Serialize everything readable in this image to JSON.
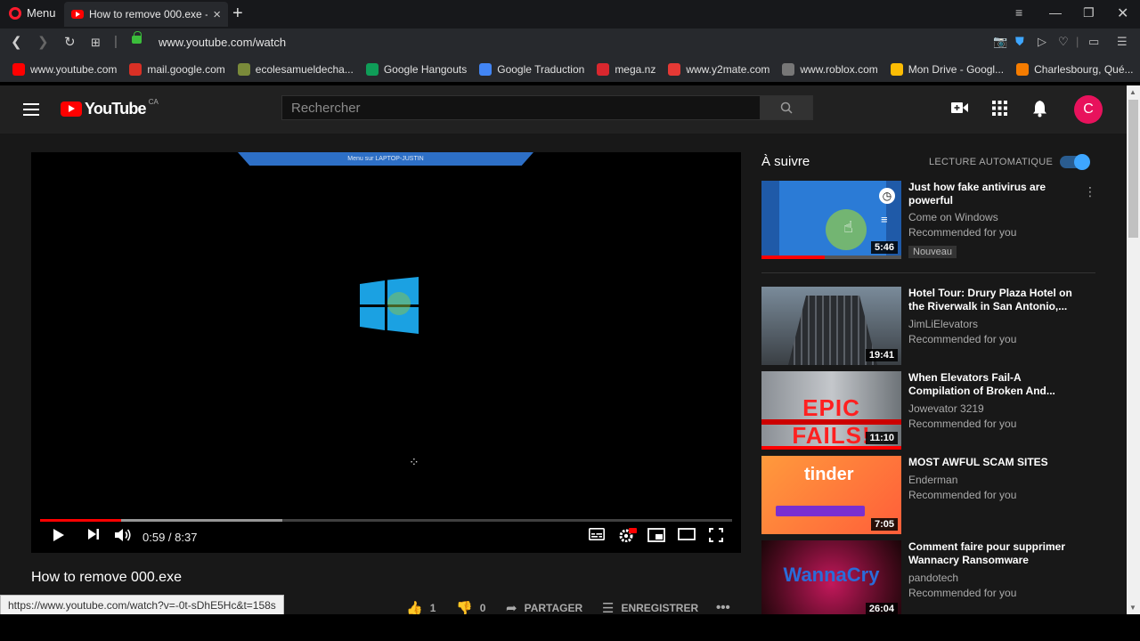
{
  "browser": {
    "menu_label": "Menu",
    "tab_title": "How to remove 000.exe - YouTube",
    "tab_close": "×",
    "new_tab": "+",
    "url": "www.youtube.com/watch",
    "bookmarks": [
      {
        "label": "www.youtube.com",
        "color": "#ff0000"
      },
      {
        "label": "mail.google.com",
        "color": "#d93025"
      },
      {
        "label": "ecolesamueldecha...",
        "color": "#7a8a3a"
      },
      {
        "label": "Google Hangouts",
        "color": "#0f9d58"
      },
      {
        "label": "Google Traduction",
        "color": "#4285f4"
      },
      {
        "label": "mega.nz",
        "color": "#d9272e"
      },
      {
        "label": "www.y2mate.com",
        "color": "#e53935"
      },
      {
        "label": "www.roblox.com",
        "color": "#777777"
      },
      {
        "label": "Mon Drive - Googl...",
        "color": "#fbbc04"
      },
      {
        "label": "Charlesbourg, Qué...",
        "color": "#f57c00"
      }
    ],
    "status_url": "https://www.youtube.com/watch?v=-0t-sDhE5Hc&t=158s"
  },
  "youtube": {
    "logo_text": "YouTube",
    "logo_region": "CA",
    "search_placeholder": "Rechercher",
    "avatar_letter": "C",
    "player": {
      "remote_title": "Menu sur LAPTOP-JUSTIN",
      "time": "0:59 / 8:37",
      "progress_fraction": 0.117,
      "buffer_fraction": 0.35
    },
    "video_title": "How to remove 000.exe",
    "actions": {
      "likes": "1",
      "dislikes": "0",
      "share": "PARTAGER",
      "save": "ENREGISTRER"
    },
    "up_next_label": "À suivre",
    "autoplay_label": "LECTURE AUTOMATIQUE",
    "recommendations": [
      {
        "title": "Just how fake antivirus are powerful",
        "channel": "Come on Windows",
        "sub": "Recommended for you",
        "duration": "5:46",
        "badge": "Nouveau"
      },
      {
        "title": "Hotel Tour: Drury Plaza Hotel on the Riverwalk in San Antonio,...",
        "channel": "JimLiElevators",
        "sub": "Recommended for you",
        "duration": "19:41"
      },
      {
        "title": "When Elevators Fail-A Compilation of Broken And...",
        "channel": "Jowevator 3219",
        "sub": "Recommended for you",
        "duration": "11:10",
        "thumb_text": "EPIC FAILS!"
      },
      {
        "title": "MOST AWFUL SCAM SITES",
        "channel": "Enderman",
        "sub": "Recommended for you",
        "duration": "7:05",
        "thumb_text": "tinder"
      },
      {
        "title": "Comment faire pour supprimer Wannacry Ransomware",
        "channel": "pandotech",
        "sub": "Recommended for you",
        "duration": "26:04",
        "thumb_text": "WannaCry"
      }
    ]
  }
}
